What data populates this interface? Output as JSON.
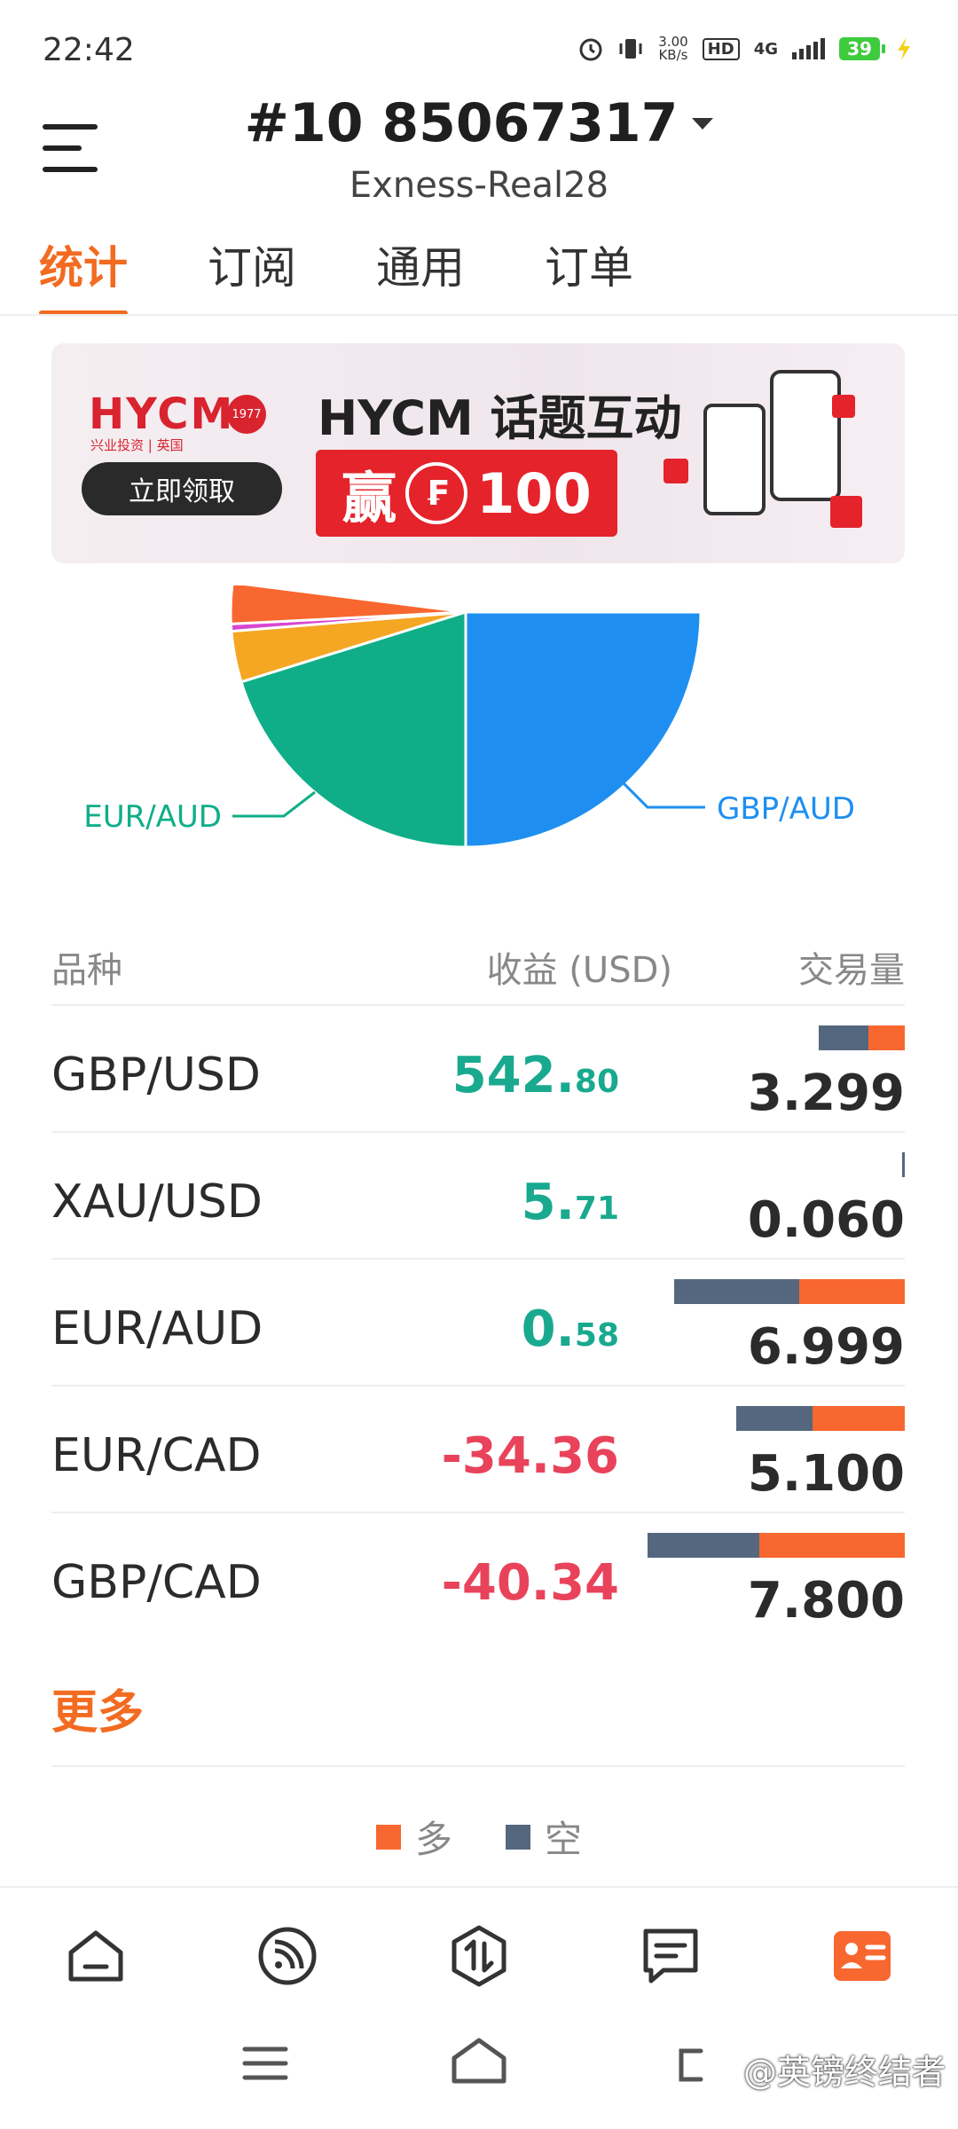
{
  "status_bar": {
    "time": "22:42",
    "net_speed_value": "3.00",
    "net_speed_unit": "KB/s",
    "hd_label": "HD",
    "network": "4G",
    "battery": "39"
  },
  "header": {
    "account_id": "#10   85067317",
    "server": "Exness-Real28"
  },
  "tabs": [
    {
      "label": "统计",
      "active": true
    },
    {
      "label": "订阅",
      "active": false
    },
    {
      "label": "通用",
      "active": false
    },
    {
      "label": "订单",
      "active": false
    }
  ],
  "banner": {
    "brand": "HYCM",
    "brand_sub": "兴业投资 | 英国",
    "seal_text": "1977",
    "button": "立即领取",
    "title": "HYCM 话题互动",
    "prize_prefix": "赢",
    "prize_currency": "₣",
    "prize_amount": "100"
  },
  "chart_data": {
    "type": "pie",
    "slices": [
      {
        "label": "GBP/AUD",
        "value": 25,
        "color": "#1e8ff0"
      },
      {
        "label": "EUR/AUD",
        "value": 20.2,
        "color": "#0fae88"
      },
      {
        "label": "",
        "value": 3.5,
        "color": "#f5a623"
      },
      {
        "label": "",
        "value": 0.5,
        "color": "#d946d3"
      },
      {
        "label": "",
        "value": 2.8,
        "color": "#f8672f"
      }
    ]
  },
  "table": {
    "headers": {
      "symbol": "品种",
      "profit": "收益 (USD)",
      "volume": "交易量"
    },
    "rows": [
      {
        "symbol": "GBP/USD",
        "profit_int": "542.",
        "profit_dec": "80",
        "sign": "pos",
        "volume": "3.299",
        "short": 1.5,
        "long": 1.1
      },
      {
        "symbol": "XAU/USD",
        "profit_int": "5.",
        "profit_dec": "71",
        "sign": "pos",
        "volume": "0.060",
        "short": 0.06,
        "long": 0
      },
      {
        "symbol": "EUR/AUD",
        "profit_int": "0.",
        "profit_dec": "58",
        "sign": "pos",
        "volume": "6.999",
        "short": 3.8,
        "long": 3.2
      },
      {
        "symbol": "EUR/CAD",
        "profit_int": "-34.36",
        "profit_dec": "",
        "sign": "neg",
        "volume": "5.100",
        "short": 2.3,
        "long": 2.8
      },
      {
        "symbol": "GBP/CAD",
        "profit_int": "-40.34",
        "profit_dec": "",
        "sign": "neg",
        "volume": "7.800",
        "short": 3.4,
        "long": 4.4
      }
    ],
    "more": "更多"
  },
  "legend": {
    "long": "多",
    "short": "空",
    "long_color": "#f8672f",
    "short_color": "#55677f"
  },
  "bottom_nav": [
    "home-icon",
    "rss-icon",
    "trade-icon",
    "message-icon",
    "profile-card-icon"
  ],
  "watermark": "@英镑终结者"
}
